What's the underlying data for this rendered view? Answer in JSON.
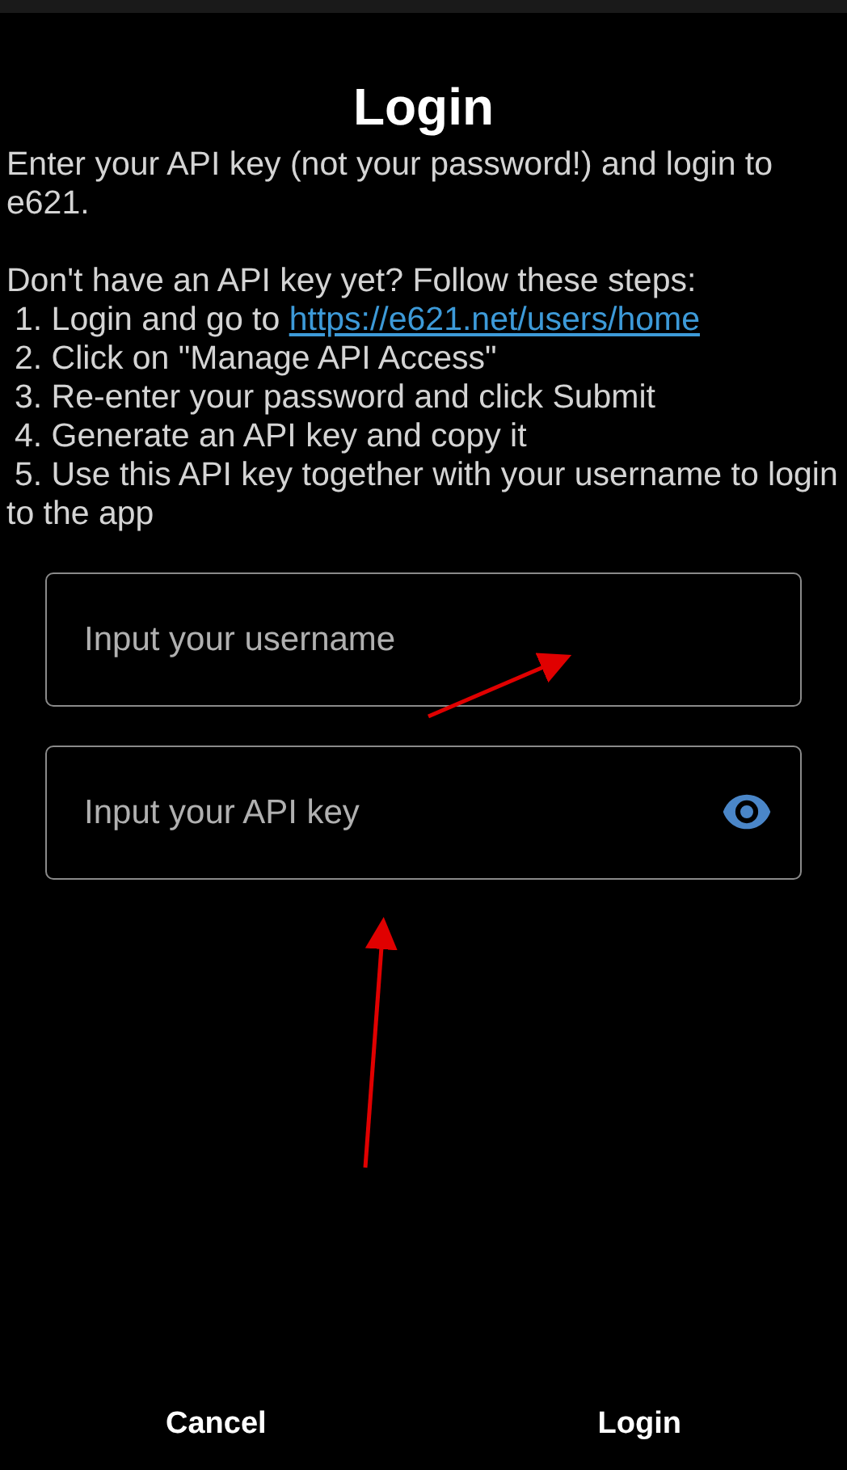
{
  "title": "Login",
  "intro": "Enter your API key (not your password!) and login to e621.",
  "steps_heading": "Don't have an API key yet? Follow these steps:",
  "steps": [
    {
      "text": "1. Login and go to ",
      "link": "https://e621.net/users/home"
    },
    {
      "text": "2. Click on \"Manage API Access\""
    },
    {
      "text": "3. Re-enter your password and click Submit"
    },
    {
      "text": "4. Generate an API key and copy it"
    },
    {
      "text": "5. Use this API key together with your username to login to the app"
    }
  ],
  "fields": [
    {
      "kind": "text",
      "placeholder": "Input your username"
    },
    {
      "kind": "password",
      "placeholder": "Input your API key"
    }
  ],
  "buttons": [
    "Cancel",
    "Login"
  ]
}
